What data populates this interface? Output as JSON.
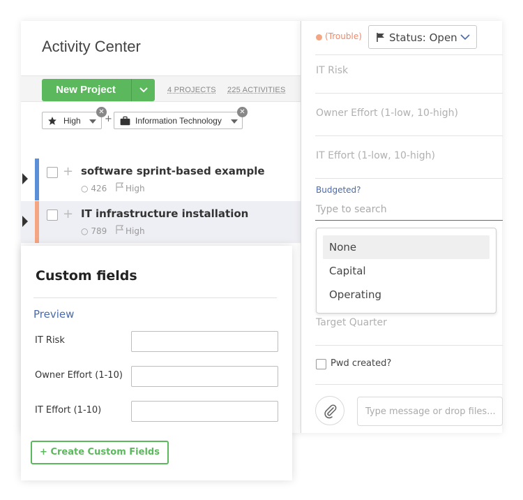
{
  "app": {
    "title": "Activity Center"
  },
  "toolbar": {
    "new_project_label": "New Project",
    "projects_count": "4 PROJECTS",
    "activities_count": "225 ACTIVITIES"
  },
  "filters": [
    {
      "label": "High",
      "icon": "star-icon"
    },
    {
      "label": "Information Technology",
      "icon": "briefcase-icon"
    }
  ],
  "filter_joiner": "+",
  "projects": [
    {
      "name": "software sprint-based example",
      "count": "426",
      "priority": "High",
      "color": "#5b8fd8"
    },
    {
      "name": "IT infrastructure installation",
      "count": "789",
      "priority": "High",
      "color": "#f4a582"
    }
  ],
  "detail": {
    "trouble_label": "(Trouble)",
    "status_label": "Status: Open",
    "fields": [
      {
        "placeholder": "IT Risk"
      },
      {
        "placeholder": "Owner Effort (1-low, 10-high)"
      },
      {
        "placeholder": "IT Effort (1-low, 10-high)"
      }
    ],
    "budget": {
      "label": "Budgeted?",
      "placeholder": "Type to search",
      "options": [
        "None",
        "Capital",
        "Operating"
      ],
      "selected": "None"
    },
    "target_quarter_placeholder": "Target Quarter",
    "pwd_label": "Pwd created?",
    "message_placeholder": "Type message or drop files..."
  },
  "custom_fields": {
    "title": "Custom fields",
    "preview_label": "Preview",
    "fields": [
      {
        "label": "IT Risk"
      },
      {
        "label": "Owner Effort (1-10)"
      },
      {
        "label": "IT Effort (1-10)"
      }
    ],
    "create_button": "+ Create Custom Fields"
  },
  "colors": {
    "accent_green": "#5cb85c",
    "link_blue": "#4a6aa8",
    "trouble_orange": "#f0896a"
  }
}
